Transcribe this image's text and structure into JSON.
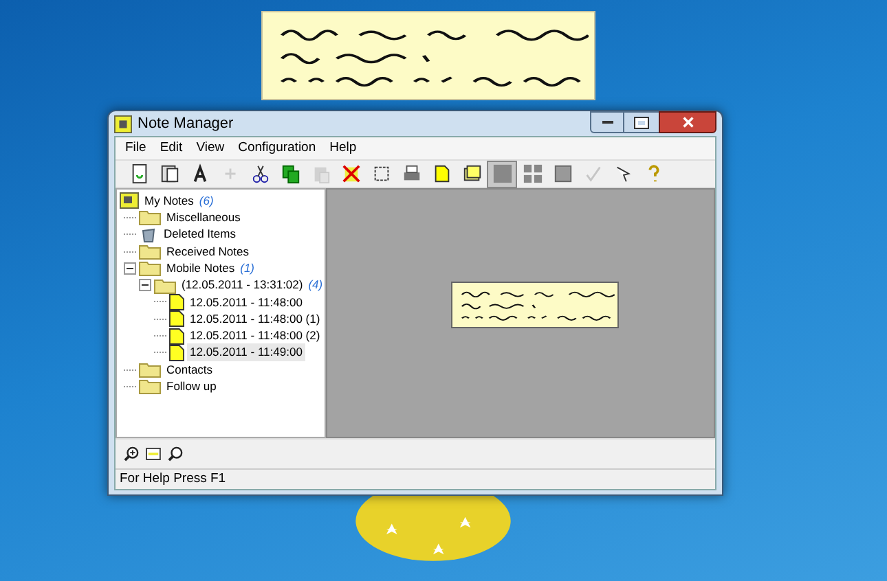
{
  "window": {
    "title": "Note Manager"
  },
  "menu": [
    "File",
    "Edit",
    "View",
    "Configuration",
    "Help"
  ],
  "toolbar": [
    {
      "kind": "new",
      "disabled": false
    },
    {
      "kind": "properties",
      "disabled": false
    },
    {
      "kind": "font",
      "disabled": false
    },
    {
      "kind": "add",
      "disabled": true
    },
    {
      "kind": "cut",
      "disabled": false
    },
    {
      "kind": "copy",
      "disabled": false
    },
    {
      "kind": "paste",
      "disabled": true
    },
    {
      "kind": "delete",
      "disabled": false
    },
    {
      "kind": "select",
      "disabled": false
    },
    {
      "kind": "print",
      "disabled": false
    },
    {
      "kind": "note",
      "disabled": false
    },
    {
      "kind": "notes",
      "disabled": false
    },
    {
      "kind": "view-large",
      "selected": true
    },
    {
      "kind": "view-grid",
      "selected": false
    },
    {
      "kind": "view-small",
      "selected": false
    },
    {
      "kind": "check",
      "disabled": true
    },
    {
      "kind": "pointer",
      "disabled": false
    },
    {
      "kind": "help",
      "disabled": false
    }
  ],
  "tree": [
    {
      "kind": "root",
      "label": "My Notes",
      "count": "(6)",
      "selected": false,
      "children": [
        {
          "kind": "folder",
          "label": "Miscellaneous",
          "selected": false
        },
        {
          "kind": "trash",
          "label": "Deleted Items",
          "selected": false
        },
        {
          "kind": "folder",
          "label": "Received Notes",
          "selected": false
        },
        {
          "kind": "folder",
          "label": "Mobile Notes",
          "count": "(1)",
          "expanded": true,
          "selected": false,
          "children": [
            {
              "kind": "folder",
              "label": "(12.05.2011 - 13:31:02)",
              "count": "(4)",
              "expanded": true,
              "selected": false,
              "children": [
                {
                  "kind": "note",
                  "label": "12.05.2011 - 11:48:00",
                  "selected": false
                },
                {
                  "kind": "note",
                  "label": "12.05.2011 - 11:48:00 (1)",
                  "selected": false
                },
                {
                  "kind": "note",
                  "label": "12.05.2011 - 11:48:00 (2)",
                  "selected": false
                },
                {
                  "kind": "note",
                  "label": "12.05.2011 - 11:49:00",
                  "selected": true
                }
              ]
            }
          ]
        },
        {
          "kind": "folder",
          "label": "Contacts",
          "selected": false
        },
        {
          "kind": "folder",
          "label": "Follow up",
          "selected": false
        }
      ]
    }
  ],
  "bottom_toolbar": [
    {
      "kind": "zoom-in"
    },
    {
      "kind": "fit"
    },
    {
      "kind": "zoom-out"
    }
  ],
  "status_bar": "For Help Press F1"
}
